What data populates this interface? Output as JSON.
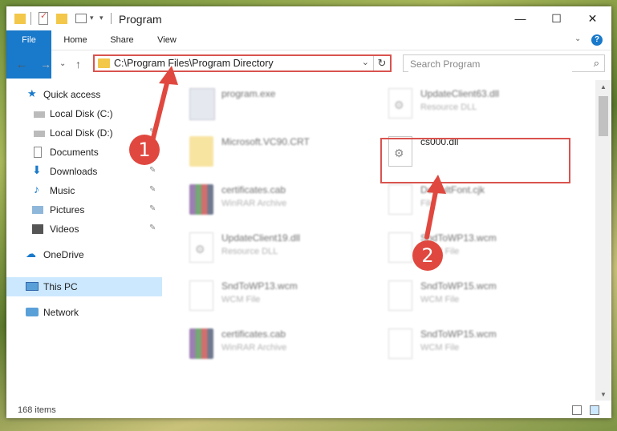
{
  "window": {
    "title": "Program",
    "controls": {
      "minimize": "—",
      "maximize": "☐",
      "close": "✕"
    }
  },
  "ribbon": {
    "tabs": [
      "File",
      "Home",
      "Share",
      "View"
    ],
    "expand": "⌄",
    "help": "?"
  },
  "nav": {
    "back": "←",
    "forward": "→",
    "recent": "⌄",
    "up": "↑",
    "address": "C:\\Program Files\\Program Directory",
    "address_chevron": "⌄",
    "refresh": "↻",
    "search_placeholder": "Search Program",
    "search_icon": "search-icon"
  },
  "sidebar": {
    "items": [
      {
        "label": "Quick access",
        "icon": "star-icon"
      },
      {
        "label": "Local Disk (C:)",
        "icon": "drive-icon",
        "pinned": true
      },
      {
        "label": "Local Disk (D:)",
        "icon": "drive-icon",
        "pinned": true
      },
      {
        "label": "Documents",
        "icon": "documents-icon",
        "pinned": true
      },
      {
        "label": "Downloads",
        "icon": "download-icon",
        "pinned": true
      },
      {
        "label": "Music",
        "icon": "music-icon",
        "pinned": true
      },
      {
        "label": "Pictures",
        "icon": "pictures-icon",
        "pinned": true
      },
      {
        "label": "Videos",
        "icon": "videos-icon",
        "pinned": true
      },
      {
        "label": "OneDrive",
        "icon": "cloud-icon"
      },
      {
        "label": "This PC",
        "icon": "computer-icon",
        "selected": true
      },
      {
        "label": "Network",
        "icon": "network-icon"
      }
    ],
    "pin_glyph": "📌"
  },
  "files": [
    {
      "name": "program.exe",
      "type": "",
      "icon": "exe"
    },
    {
      "name": "UpdateClient63.dll",
      "type": "Resource DLL",
      "icon": "dll"
    },
    {
      "name": "Microsoft.VC90.CRT",
      "type": "",
      "icon": "folder"
    },
    {
      "name": "cs000.dll",
      "type": "",
      "icon": "dll"
    },
    {
      "name": "certificates.cab",
      "type": "WinRAR Archive",
      "icon": "rar"
    },
    {
      "name": "DefaultFont.cjk",
      "type": "File",
      "icon": "doc"
    },
    {
      "name": "UpdateClient19.dll",
      "type": "Resource DLL",
      "icon": "dll"
    },
    {
      "name": "SndToWP13.wcm",
      "type": "WCM File",
      "icon": "doc"
    },
    {
      "name": "SndToWP13.wcm",
      "type": "WCM File",
      "icon": "doc"
    },
    {
      "name": "SndToWP15.wcm",
      "type": "WCM File",
      "icon": "doc"
    },
    {
      "name": "certificates.cab",
      "type": "WinRAR Archive",
      "icon": "rar"
    },
    {
      "name": "SndToWP15.wcm",
      "type": "WCM File",
      "icon": "doc"
    }
  ],
  "status": {
    "count": "168 items"
  },
  "annotations": {
    "step1": "1",
    "step2": "2",
    "color": "#e0483f"
  }
}
